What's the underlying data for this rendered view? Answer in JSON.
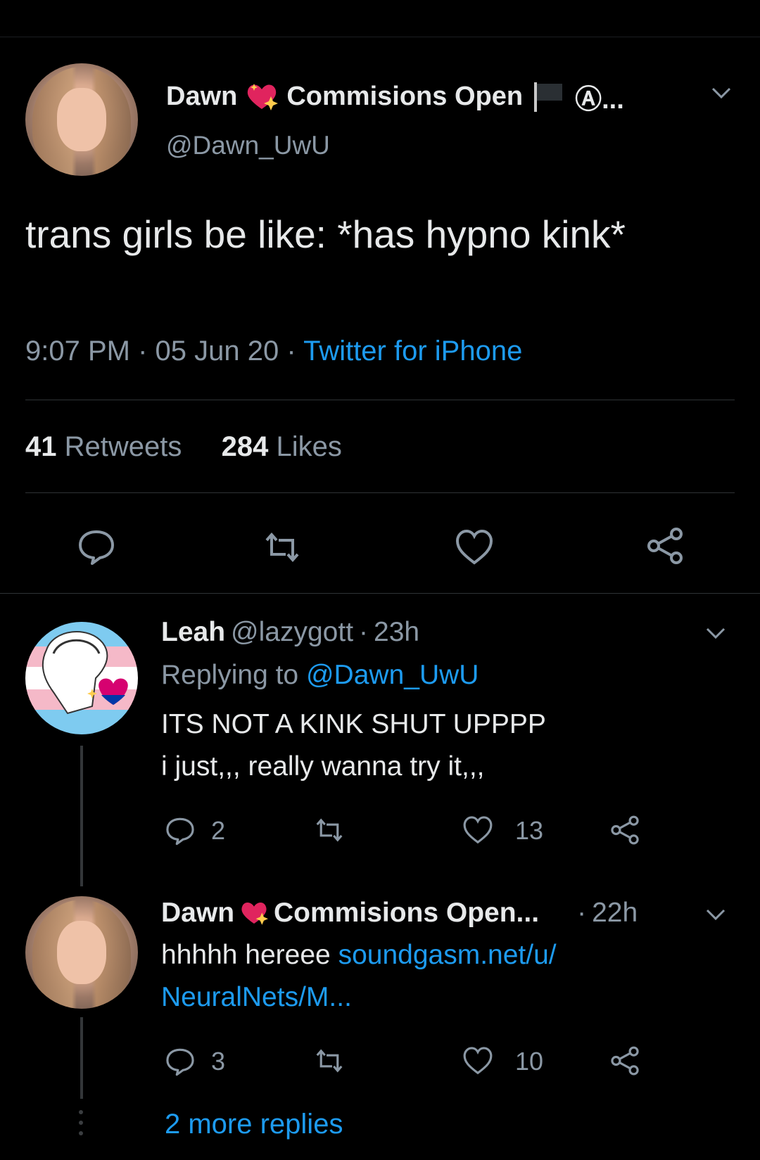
{
  "main_tweet": {
    "display_name": "Dawn",
    "name_suffix": "Commisions Open",
    "name_tail": "Ⓐ...",
    "handle": "@Dawn_UwU",
    "text": "trans girls be like: *has hypno kink*",
    "time": "9:07 PM",
    "date": "05 Jun 20",
    "source": "Twitter for iPhone",
    "retweets_count": "41",
    "retweets_label": "Retweets",
    "likes_count": "284",
    "likes_label": "Likes"
  },
  "replies": [
    {
      "display_name": "Leah",
      "handle": "@lazygott",
      "time": "23h",
      "replying_prefix": "Replying to",
      "replying_to": "@Dawn_UwU",
      "line1": "ITS NOT A KINK SHUT UPPPP",
      "line2": "i just,,, really wanna try it,,,",
      "reply_count": "2",
      "retweet_count": "",
      "like_count": "13"
    },
    {
      "display_name": "Dawn",
      "name_suffix": "Commisions Open...",
      "time": "22h",
      "text_prefix": "hhhhh hereee",
      "link_line1": "soundgasm.net/u/",
      "link_line2": "NeuralNets/M...",
      "reply_count": "3",
      "retweet_count": "",
      "like_count": "10"
    }
  ],
  "more_replies": "2 more replies",
  "colors": {
    "background": "#000000",
    "link": "#1d9bf0",
    "secondary_text": "#8b98a5",
    "divider": "#2f3336"
  },
  "icons": [
    "chevron-down-icon",
    "sparkling-heart-emoji",
    "black-flag-emoji",
    "anarchy-symbol",
    "reply-icon",
    "retweet-icon",
    "like-icon",
    "share-icon"
  ]
}
